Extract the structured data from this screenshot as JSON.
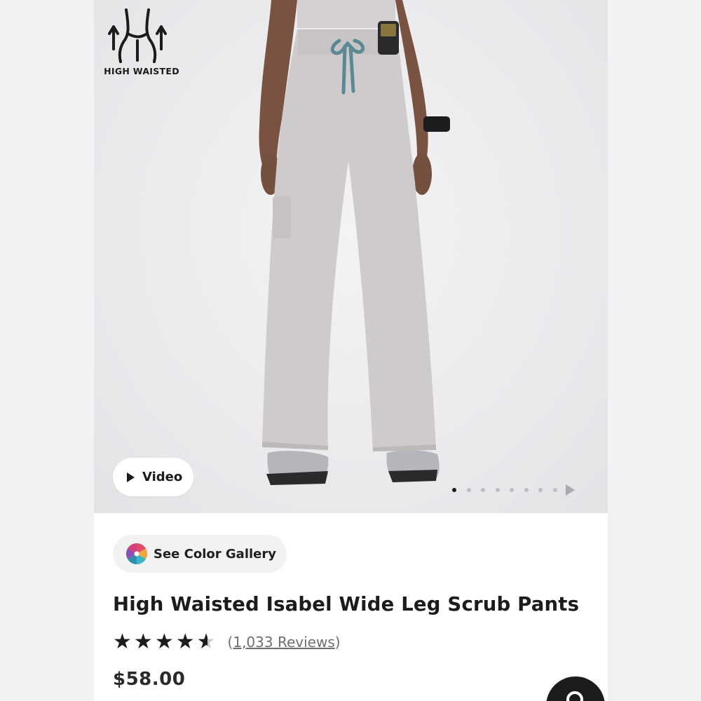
{
  "badge": {
    "label": "HIGH WAISTED",
    "icon": "high-waist-icon"
  },
  "video_button": {
    "label": "Video",
    "icon": "play-icon"
  },
  "carousel": {
    "total_dots": 8,
    "active_index": 0,
    "next_icon": "play-arrow-icon"
  },
  "color_gallery": {
    "label": "See Color Gallery",
    "icon": "color-palette-icon"
  },
  "product": {
    "title": "High Waisted Isabel Wide Leg Scrub Pants",
    "rating": 4.5,
    "reviews_open": "(",
    "reviews_text": "1,033 Reviews",
    "reviews_close": ")",
    "price": "$58.00"
  },
  "search_button": {
    "icon": "search-icon"
  },
  "colors": {
    "pants": "#cfcbcc",
    "drawstring": "#5a8a94",
    "text": "#1c1c1c"
  }
}
